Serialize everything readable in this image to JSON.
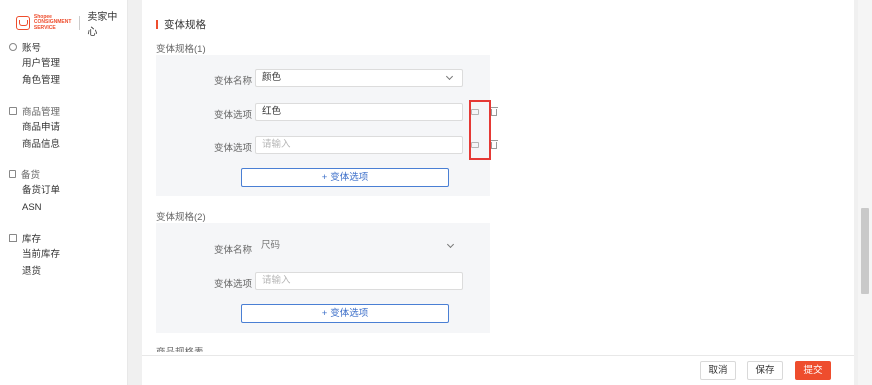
{
  "logo": {
    "line1": "Shopee",
    "line2": "CONSIGNMENT",
    "line3": "SERVICE",
    "center_label": "卖家中心"
  },
  "sidebar": {
    "groups": [
      {
        "label": "账号",
        "icon": "user-icon",
        "items": [
          "用户管理",
          "角色管理"
        ]
      },
      {
        "label": "商品管理",
        "icon": "box-icon",
        "items": [
          "商品申请",
          "商品信息"
        ]
      },
      {
        "label": "备货",
        "icon": "document-icon",
        "items": [
          "备货订单",
          "ASN"
        ]
      },
      {
        "label": "库存",
        "icon": "warehouse-icon",
        "items": [
          "当前库存",
          "退货"
        ]
      }
    ]
  },
  "section": {
    "title": "变体规格"
  },
  "spec1": {
    "label": "变体规格(1)",
    "name_label": "变体名称",
    "name_value": "颜色",
    "options": [
      {
        "label": "变体选项",
        "value": "红色",
        "placeholder": ""
      },
      {
        "label": "变体选项",
        "value": "",
        "placeholder": "请输入"
      }
    ],
    "add_label": "变体选项"
  },
  "spec2": {
    "label": "变体规格(2)",
    "name_label": "变体名称",
    "name_value": "尺码",
    "options": [
      {
        "label": "变体选项",
        "value": "",
        "placeholder": "请输入"
      }
    ],
    "add_label": "变体选项"
  },
  "next_section_label": "商品规格表",
  "footer": {
    "cancel": "取消",
    "save": "保存",
    "submit": "提交"
  },
  "colors": {
    "accent": "#ee4d2d",
    "link": "#3b6ec9",
    "highlight": "#e53935"
  }
}
